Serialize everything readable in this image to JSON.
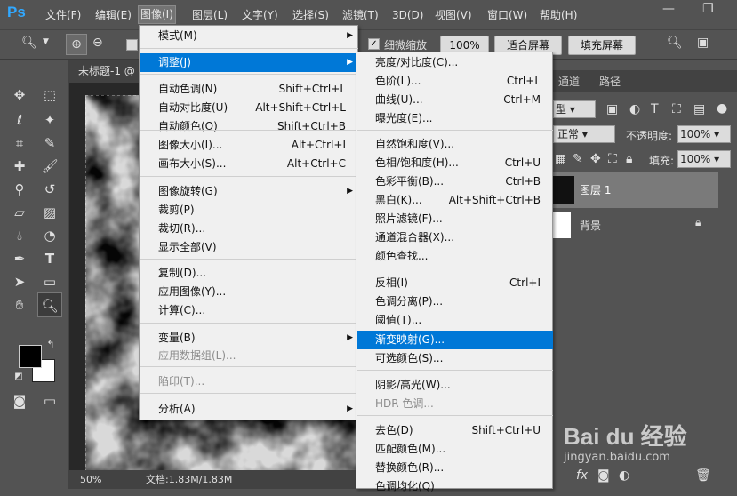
{
  "menubar": {
    "logo": "Ps",
    "items": [
      "文件(F)",
      "编辑(E)",
      "图像(I)",
      "图层(L)",
      "文字(Y)",
      "选择(S)",
      "滤镜(T)",
      "3D(D)",
      "视图(V)",
      "窗口(W)",
      "帮助(H)"
    ],
    "active": "图像(I)"
  },
  "optbar": {
    "checkbox_label": "细微缩放",
    "zoom_value": "100%",
    "fit_screen": "适合屏幕",
    "fill_screen": "填充屏幕"
  },
  "document": {
    "tab_title": "未标题-1 @"
  },
  "status": {
    "zoom": "50%",
    "doc_info": "文档:1.83M/1.83M"
  },
  "panel": {
    "tabs": [
      "通道",
      "路径"
    ],
    "kind_value": "型",
    "opacity_label": "不透明度:",
    "opacity_value": "100%",
    "fill_label": "填充:",
    "fill_value": "100%",
    "layers": [
      {
        "name": "图层 1"
      },
      {
        "name": "背景"
      }
    ],
    "normal_mode": "正常"
  },
  "image_menu": {
    "items": [
      {
        "label": "模式(M)",
        "shortcut": "",
        "sub": true
      },
      {
        "label": "调整(J)",
        "shortcut": "",
        "sub": true,
        "highlight": true
      },
      {
        "label": "自动色调(N)",
        "shortcut": "Shift+Ctrl+L"
      },
      {
        "label": "自动对比度(U)",
        "shortcut": "Alt+Shift+Ctrl+L"
      },
      {
        "label": "自动颜色(O)",
        "shortcut": "Shift+Ctrl+B"
      },
      {
        "label": "图像大小(I)...",
        "shortcut": "Alt+Ctrl+I"
      },
      {
        "label": "画布大小(S)...",
        "shortcut": "Alt+Ctrl+C"
      },
      {
        "label": "图像旋转(G)",
        "shortcut": "",
        "sub": true
      },
      {
        "label": "裁剪(P)",
        "shortcut": ""
      },
      {
        "label": "裁切(R)...",
        "shortcut": ""
      },
      {
        "label": "显示全部(V)",
        "shortcut": ""
      },
      {
        "label": "复制(D)...",
        "shortcut": ""
      },
      {
        "label": "应用图像(Y)...",
        "shortcut": ""
      },
      {
        "label": "计算(C)...",
        "shortcut": ""
      },
      {
        "label": "变量(B)",
        "shortcut": "",
        "sub": true
      },
      {
        "label": "应用数据组(L)...",
        "shortcut": "",
        "disabled": true
      },
      {
        "label": "陷印(T)...",
        "shortcut": "",
        "disabled": true
      },
      {
        "label": "分析(A)",
        "shortcut": "",
        "sub": true
      }
    ]
  },
  "adjust_menu": {
    "items": [
      {
        "label": "亮度/对比度(C)...",
        "shortcut": ""
      },
      {
        "label": "色阶(L)...",
        "shortcut": "Ctrl+L"
      },
      {
        "label": "曲线(U)...",
        "shortcut": "Ctrl+M"
      },
      {
        "label": "曝光度(E)...",
        "shortcut": ""
      },
      {
        "label": "自然饱和度(V)...",
        "shortcut": ""
      },
      {
        "label": "色相/饱和度(H)...",
        "shortcut": "Ctrl+U"
      },
      {
        "label": "色彩平衡(B)...",
        "shortcut": "Ctrl+B"
      },
      {
        "label": "黑白(K)...",
        "shortcut": "Alt+Shift+Ctrl+B"
      },
      {
        "label": "照片滤镜(F)...",
        "shortcut": ""
      },
      {
        "label": "通道混合器(X)...",
        "shortcut": ""
      },
      {
        "label": "颜色查找...",
        "shortcut": ""
      },
      {
        "label": "反相(I)",
        "shortcut": "Ctrl+I"
      },
      {
        "label": "色调分离(P)...",
        "shortcut": ""
      },
      {
        "label": "阈值(T)...",
        "shortcut": ""
      },
      {
        "label": "渐变映射(G)...",
        "shortcut": "",
        "highlight": true
      },
      {
        "label": "可选颜色(S)...",
        "shortcut": ""
      },
      {
        "label": "阴影/高光(W)...",
        "shortcut": ""
      },
      {
        "label": "HDR 色调...",
        "shortcut": "",
        "disabled": true
      },
      {
        "label": "去色(D)",
        "shortcut": "Shift+Ctrl+U"
      },
      {
        "label": "匹配颜色(M)...",
        "shortcut": ""
      },
      {
        "label": "替换颜色(R)...",
        "shortcut": ""
      },
      {
        "label": "色调均化(Q)",
        "shortcut": ""
      }
    ]
  },
  "watermark": {
    "brand": "Bai du 经验",
    "url": "jingyan.baidu.com"
  }
}
